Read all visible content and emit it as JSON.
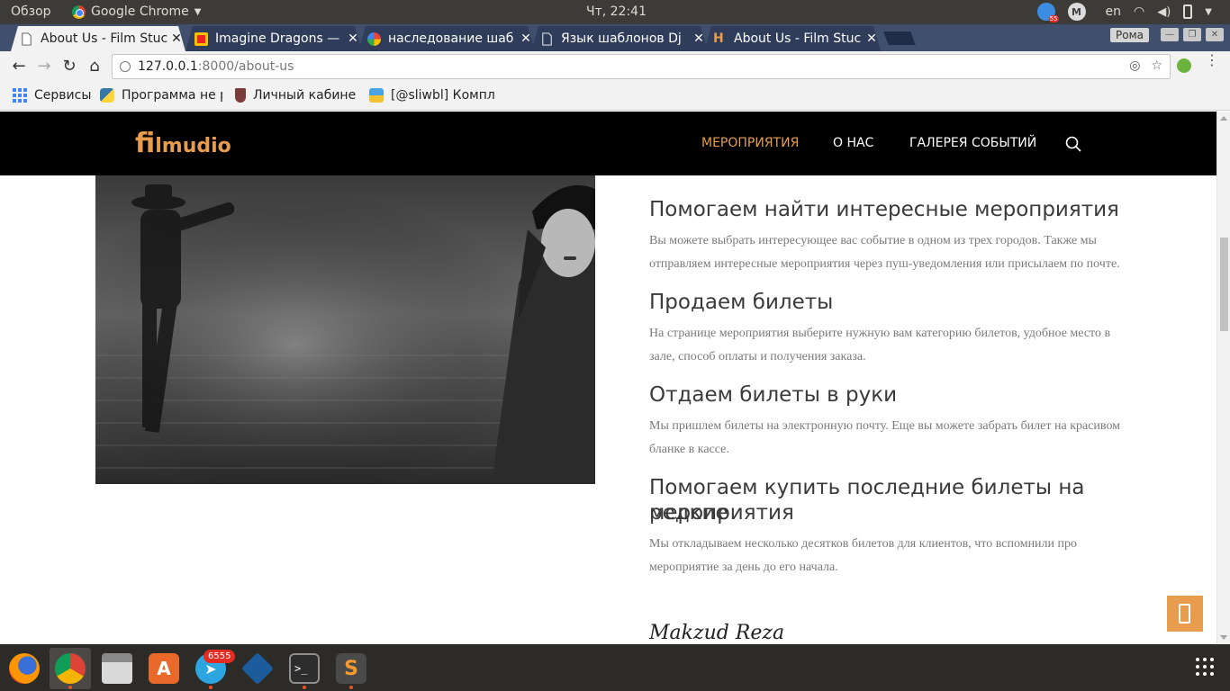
{
  "system": {
    "overview": "Обзор",
    "app_name": "Google Chrome",
    "clock": "Чт, 22:41",
    "lang": "en",
    "badge_count": "55"
  },
  "tabs": [
    {
      "title": "About Us - Film Stuc",
      "active": true
    },
    {
      "title": "Imagine Dragons — ",
      "active": false
    },
    {
      "title": "наследование шаб",
      "active": false
    },
    {
      "title": "Язык шаблонов Dj",
      "active": false
    },
    {
      "title": "About Us - Film Stuc",
      "active": false
    }
  ],
  "profile_name": "Рома",
  "address": {
    "host": "127.0.0.1",
    "path": ":8000/about-us"
  },
  "bookmarks": [
    {
      "label": "Сервисы"
    },
    {
      "label": "Программа не р"
    },
    {
      "label": "Личный кабине"
    },
    {
      "label": "[@sliwbl] Компл"
    }
  ],
  "site": {
    "logo_big": "fi",
    "logo_rest": "lmudio",
    "nav": [
      {
        "label": "МЕРОПРИЯТИЯ",
        "active": true
      },
      {
        "label": "О НАС",
        "active": false
      },
      {
        "label": "ГАЛЕРЕЯ СОБЫТИЙ",
        "active": false
      }
    ],
    "sections": [
      {
        "title": "Помогаем найти интересные мероприятия",
        "line1": "Вы можете выбрать интересующее вас событие в одном из трех городов. Также мы",
        "line2": "отправляем интересные мероприятия через пуш-уведомления или присылаем по почте."
      },
      {
        "title": "Продаем билеты",
        "line1": "На странице мероприятия выберите нужную вам категорию билетов, удобное место в",
        "line2": "зале, способ оплаты и получения заказа."
      },
      {
        "title": "Отдаем билеты в руки",
        "line1": "Мы пришлем билеты на электронную почту. Еще вы можете забрать билет на красивом",
        "line2": "бланке в кассе."
      },
      {
        "title_line1": "Помогаем купить последние билеты на редкие",
        "title_line2": "мероприятия",
        "line1": "Мы откладываем несколько десятков билетов для клиентов, что вспомнили про",
        "line2": "мероприятие за день до его начала."
      }
    ],
    "signature": "Makzud Reza"
  },
  "dock": {
    "telegram_badge": "6555"
  },
  "colors": {
    "accent": "#e79c4e",
    "header_bg": "#000000",
    "heading": "#3a3a3a",
    "body_text": "#7a7a7a"
  }
}
